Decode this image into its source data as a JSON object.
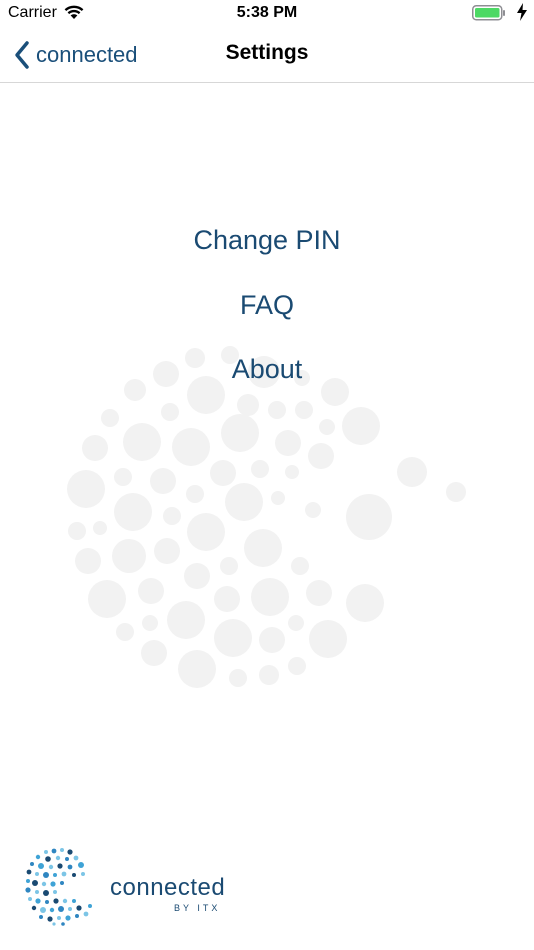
{
  "status_bar": {
    "carrier": "Carrier",
    "time": "5:38 PM",
    "battery_color": "#4cd964"
  },
  "nav": {
    "back_label": "connected",
    "title": "Settings",
    "accent_color": "#1a4f7a"
  },
  "menu": {
    "items": [
      {
        "label": "Change PIN"
      },
      {
        "label": "FAQ"
      },
      {
        "label": "About"
      }
    ]
  },
  "logo": {
    "wordmark": "connected",
    "subtext": "BY ITX"
  },
  "icons": [
    "wifi-icon",
    "battery-icon",
    "charging-bolt-icon",
    "chevron-left-icon",
    "dots-watermark-graphic",
    "connected-logo-mark"
  ]
}
